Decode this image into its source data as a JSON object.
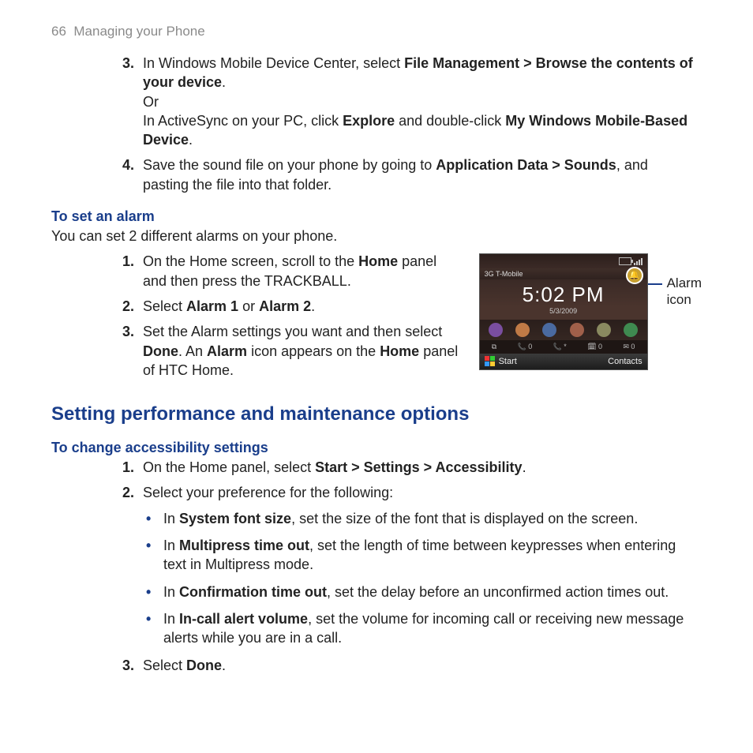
{
  "header": {
    "page_num": "66",
    "section": "Managing your Phone"
  },
  "top_steps": {
    "s3": {
      "num": "3.",
      "pre": "In Windows Mobile Device Center, select ",
      "b1": "File Management > Browse the contents of your device",
      "post1": ".",
      "or": "Or",
      "line2_pre": "In ActiveSync on your PC, click ",
      "line2_b1": "Explore",
      "line2_mid": " and double-click ",
      "line2_b2": "My Windows Mobile-Based Device",
      "line2_post": "."
    },
    "s4": {
      "num": "4.",
      "pre": "Save the sound file on your phone by going to ",
      "b1": "Application Data > Sounds",
      "post": ", and pasting the file into that folder."
    }
  },
  "alarm": {
    "heading": "To set an alarm",
    "intro": "You can set 2 different alarms on your phone.",
    "s1": {
      "num": "1.",
      "pre": "On the Home screen, scroll to the ",
      "b1": "Home",
      "post": " panel and then press the TRACKBALL."
    },
    "s2": {
      "num": "2.",
      "pre": "Select ",
      "b1": "Alarm 1",
      "mid": " or ",
      "b2": "Alarm 2",
      "post": "."
    },
    "s3": {
      "num": "3.",
      "pre": "Set the Alarm settings you want and then select ",
      "b1": "Done",
      "mid": ". An ",
      "b2": "Alarm",
      "mid2": " icon appears on the ",
      "b3": "Home",
      "post": " panel of HTC Home."
    },
    "callout_l1": "Alarm",
    "callout_l2": "icon"
  },
  "phone": {
    "carrier": "3G T-Mobile",
    "time": "5:02 PM",
    "date": "5/3/2009",
    "status_items": [
      "0",
      "*",
      "0",
      "0"
    ],
    "soft_left": "Start",
    "soft_right": "Contacts",
    "alarm_glyph": "🔔"
  },
  "perf": {
    "heading": "Setting performance and maintenance options",
    "sub": "To change accessibility settings",
    "s1": {
      "num": "1.",
      "pre": "On the Home panel, select ",
      "b1": "Start > Settings > Accessibility",
      "post": "."
    },
    "s2": {
      "num": "2.",
      "text": "Select your preference for the following:"
    },
    "bullets": {
      "b1": {
        "pre": "In ",
        "bold": "System font size",
        "post": ", set the size of the font that is displayed on the screen."
      },
      "b2": {
        "pre": "In ",
        "bold": "Multipress time out",
        "post": ", set the length of time between keypresses when entering text in Multipress mode."
      },
      "b3": {
        "pre": "In ",
        "bold": "Confirmation time out",
        "post": ", set the delay before an unconfirmed action times out."
      },
      "b4": {
        "pre": "In ",
        "bold": "In-call alert volume",
        "post": ", set the volume for incoming call or receiving new message alerts while you are in a call."
      }
    },
    "s3": {
      "num": "3.",
      "pre": "Select ",
      "b1": "Done",
      "post": "."
    }
  }
}
